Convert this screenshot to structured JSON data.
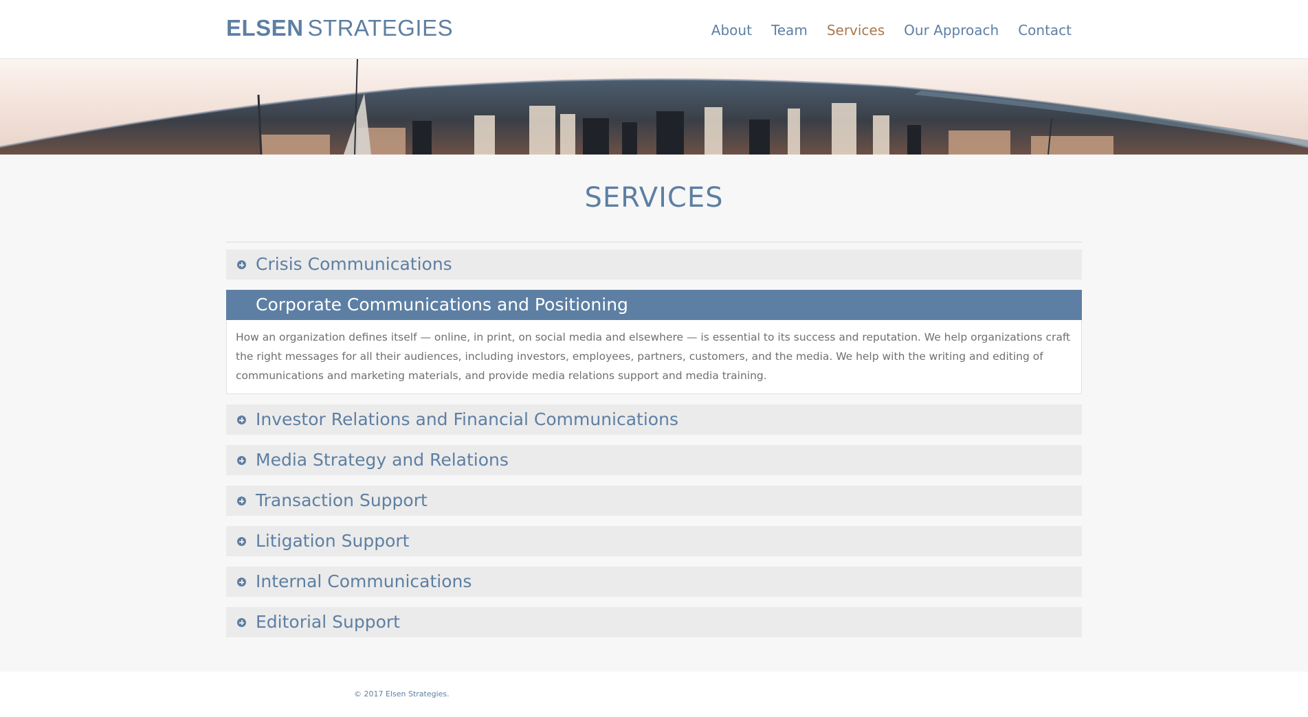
{
  "brand": {
    "bold": "ELSEN",
    "light": "STRATEGIES"
  },
  "nav": {
    "items": [
      {
        "label": "About",
        "active": false
      },
      {
        "label": "Team",
        "active": false
      },
      {
        "label": "Services",
        "active": true
      },
      {
        "label": "Our Approach",
        "active": false
      },
      {
        "label": "Contact",
        "active": false
      }
    ]
  },
  "hero": {
    "image": "city-skyline-panorama"
  },
  "page": {
    "title": "SERVICES"
  },
  "services": [
    {
      "label": "Crisis Communications",
      "open": false
    },
    {
      "label": "Corporate Communications and Positioning",
      "open": true,
      "body": "How an organization defines itself — online, in print, on social media and elsewhere — is essential to its success and reputation. We help organizations craft the right messages for all their audiences, including investors, employees, partners, customers, and the media. We help with the writing and editing of communications and marketing materials, and provide media relations support and media training."
    },
    {
      "label": "Investor Relations and Financial Communications",
      "open": false
    },
    {
      "label": "Media Strategy and Relations",
      "open": false
    },
    {
      "label": "Transaction Support",
      "open": false
    },
    {
      "label": "Litigation Support",
      "open": false
    },
    {
      "label": "Internal Communications",
      "open": false
    },
    {
      "label": "Editorial Support",
      "open": false
    }
  ],
  "footer": {
    "copyright": "© 2017 Elsen Strategies."
  },
  "colors": {
    "accent": "#5d7fa3",
    "active_nav": "#a8784f",
    "panel": "#ebebeb",
    "page_bg": "#f7f7f7"
  }
}
